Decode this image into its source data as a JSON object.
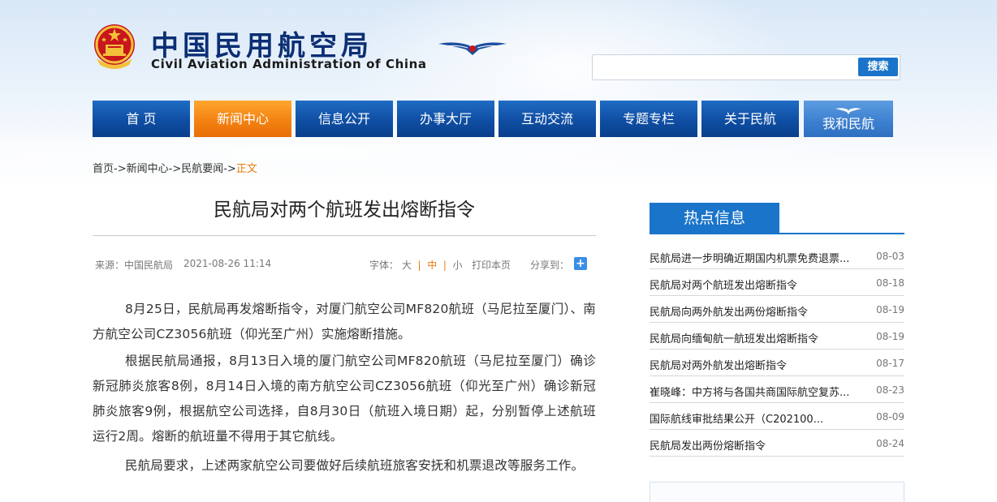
{
  "header": {
    "title_cn": "中国民用航空局",
    "title_en": "Civil Aviation Administration of China"
  },
  "search": {
    "placeholder": "",
    "button_label": "搜索"
  },
  "nav": {
    "items": [
      {
        "label": "首 页"
      },
      {
        "label": "新闻中心"
      },
      {
        "label": "信息公开"
      },
      {
        "label": "办事大厅"
      },
      {
        "label": "互动交流"
      },
      {
        "label": "专题专栏"
      },
      {
        "label": "关于民航"
      },
      {
        "label": "我和民航"
      }
    ]
  },
  "breadcrumb": {
    "home": "首页",
    "news_center": "新闻中心",
    "news": "民航要闻",
    "separator": "->",
    "current": "正文"
  },
  "article": {
    "title": "民航局对两个航班发出熔断指令",
    "source_label": "来源：",
    "source": "中国民航局",
    "datetime": "2021-08-26 11:14",
    "font_label": "字体：",
    "font_large": "大",
    "font_medium": "中",
    "font_small": "小",
    "font_sep": "|",
    "print_label": "打印本页",
    "share_label": "分享到：",
    "paragraphs": [
      "8月25日，民航局再发熔断指令，对厦门航空公司MF820航班（马尼拉至厦门）、南方航空公司CZ3056航班（仰光至广州）实施熔断措施。",
      "根据民航局通报，8月13日入境的厦门航空公司MF820航班（马尼拉至厦门）确诊新冠肺炎旅客8例，8月14日入境的南方航空公司CZ3056航班（仰光至广州）确诊新冠肺炎旅客9例，根据航空公司选择，自8月30日（航班入境日期）起，分别暂停上述航班运行2周。熔断的航班量不得用于其它航线。",
      "民航局要求，上述两家航空公司要做好后续航班旅客安抚和机票退改等服务工作。"
    ]
  },
  "sidebar": {
    "heading": "热点信息",
    "items": [
      {
        "title": "民航局进一步明确近期国内机票免费退票...",
        "date": "08-03"
      },
      {
        "title": "民航局对两个航班发出熔断指令",
        "date": "08-18"
      },
      {
        "title": "民航局向两外航发出两份熔断指令",
        "date": "08-19"
      },
      {
        "title": "民航局向缅甸航一航班发出熔断指令",
        "date": "08-19"
      },
      {
        "title": "民航局对两外航发出熔断指令",
        "date": "08-17"
      },
      {
        "title": "崔晓峰：中方将与各国共商国际航空复苏...",
        "date": "08-23"
      },
      {
        "title": "国际航线审批结果公开（C202100...",
        "date": "08-09"
      },
      {
        "title": "民航局发出两份熔断指令",
        "date": "08-24"
      }
    ]
  },
  "colors": {
    "nav_blue": "#0f4ea3",
    "nav_active": "#f27f10",
    "accent_blue": "#1a74c9",
    "breadcrumb_current": "#e87b0c",
    "title_navy": "#0b2e74"
  }
}
